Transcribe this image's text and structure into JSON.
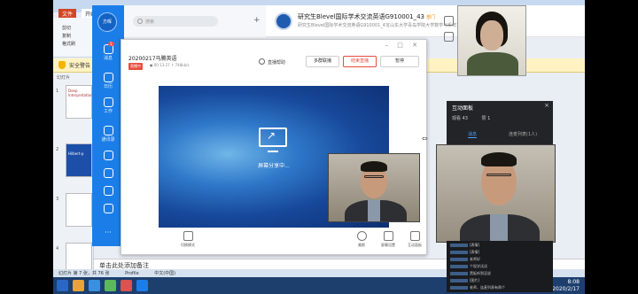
{
  "ppt": {
    "tabs": [
      "文件",
      "开始"
    ],
    "ribbon_items": [
      "剪切",
      "复制",
      "格式刷"
    ],
    "security_text": "安全警告",
    "panel_tabs": "幻灯片",
    "slide_numbers": [
      "1",
      "2",
      "3",
      "4"
    ],
    "thumb_title_1": "Deep Interpretation",
    "thumb_title_2": "Hilbert-p",
    "notes_placeholder": "单击此处添加备注",
    "status_text": "幻灯片 第 7 张，共 76 张",
    "status_theme": "Profile",
    "status_lang": "中文(中国)",
    "clock_time": "8:08",
    "clock_date": "2020/2/17"
  },
  "sidebar": {
    "avatar_label": "方晖",
    "items": [
      {
        "label": "消息",
        "badge": "1"
      },
      {
        "label": "日历"
      },
      {
        "label": "工作"
      },
      {
        "label": "通讯录"
      },
      {
        "label": ""
      },
      {
        "label": ""
      },
      {
        "label": ""
      },
      {
        "label": ""
      }
    ]
  },
  "chatlist": {
    "search_placeholder": "搜索",
    "add_label": "+"
  },
  "group": {
    "name": "研究生Blevel国际学术交流英语G910001_43",
    "tag": "部门",
    "subtitle": "研究生Blevel国际学术交流英语G910001_43[山东大学青岛学院大学数学与系统]"
  },
  "live": {
    "title": "20200217马腾英语",
    "badge": "直播中",
    "meta": "● 00:13:27  ↑ 748kb/s",
    "help_label": "直播帮助",
    "btn_connect": "多群联播",
    "btn_end": "结束直播",
    "btn_pause": "暂停",
    "share_text": "屏幕分享中...",
    "tools": [
      "切换模式",
      "美颜",
      "屏幕设置",
      "互动面板"
    ]
  },
  "interaction": {
    "title": "互动面板",
    "online": "观看 43",
    "likes": "赞 1",
    "tabs": [
      "消息",
      "连麦列表(1人)"
    ],
    "chat_lines": [
      "[表情]",
      "[表情]",
      "老师好",
      "个现学试试",
      "黑板听到没说",
      "[图片]",
      "老师，连麦列表有两个"
    ]
  },
  "colors": {
    "ding_blue": "#1b7ee8",
    "live_red": "#e94b3c",
    "panel_bg": "#232427",
    "accent_blue": "#4aa3ff"
  }
}
